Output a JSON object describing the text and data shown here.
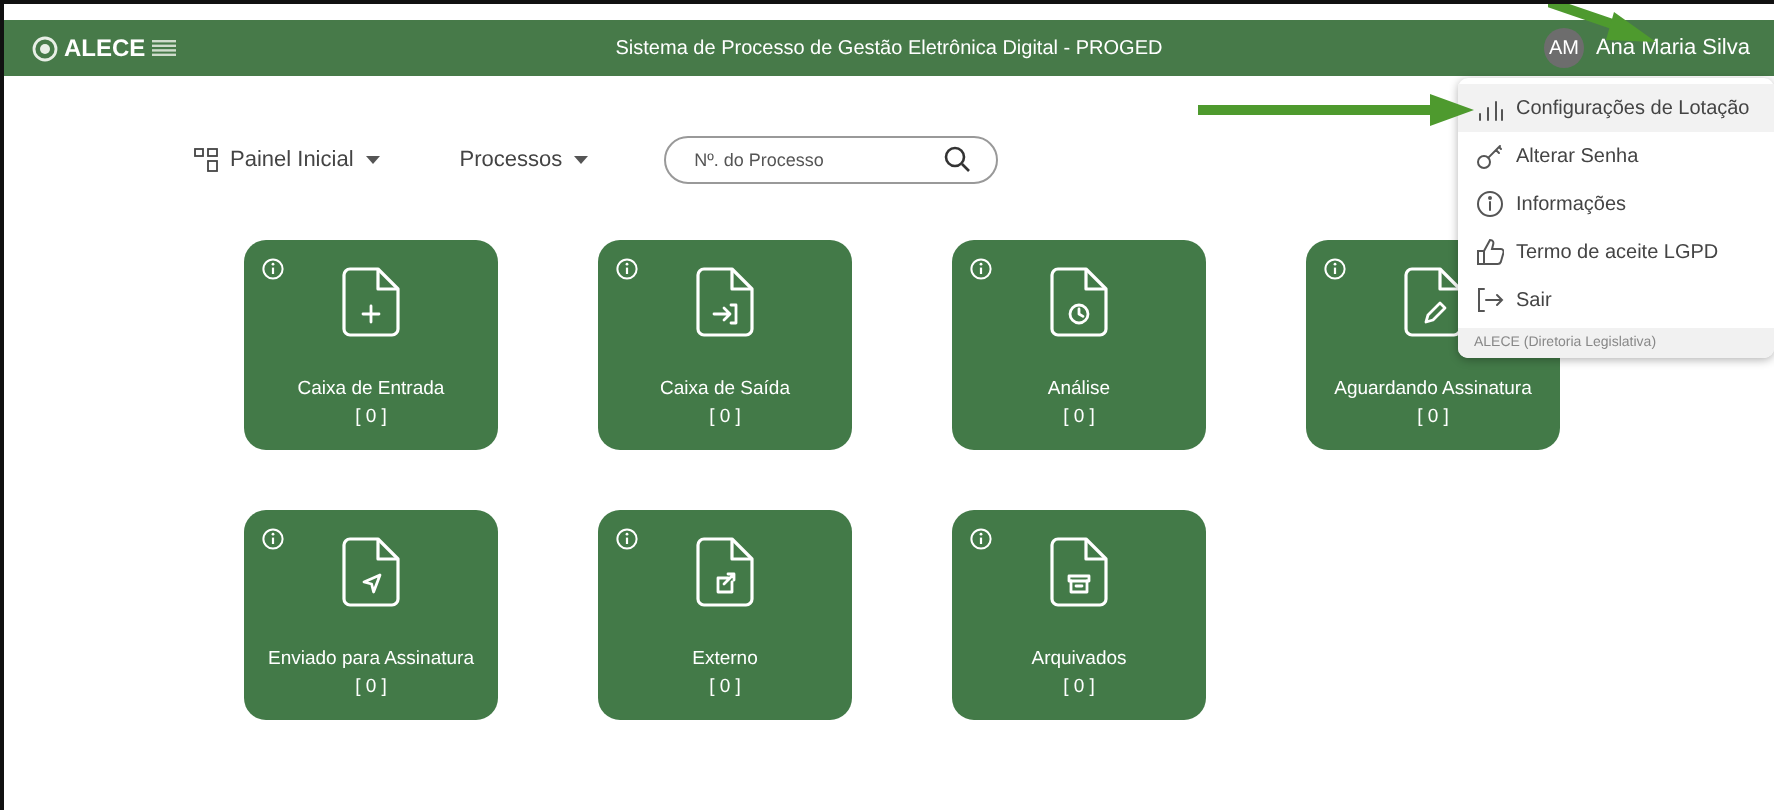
{
  "header": {
    "logo_text": "ALECE",
    "title": "Sistema de Processo de Gestão Eletrônica Digital - PROGED",
    "user": {
      "initials": "AM",
      "name": "Ana Maria Silva"
    }
  },
  "nav": {
    "items": [
      {
        "label": "Painel Inicial",
        "kind": "grid"
      },
      {
        "label": "Processos",
        "kind": "plain"
      }
    ],
    "search": {
      "placeholder": "Nº. do Processo"
    }
  },
  "cards": [
    {
      "label": "Caixa de Entrada",
      "count": "[ 0 ]",
      "kind": "plus"
    },
    {
      "label": "Caixa de Saída",
      "count": "[ 0 ]",
      "kind": "enter"
    },
    {
      "label": "Análise",
      "count": "[ 0 ]",
      "kind": "clock"
    },
    {
      "label": "Aguardando Assinatura",
      "count": "[ 0 ]",
      "kind": "pen"
    },
    {
      "label": "Enviado para Assinatura",
      "count": "[ 0 ]",
      "kind": "send"
    },
    {
      "label": "Externo",
      "count": "[ 0 ]",
      "kind": "external"
    },
    {
      "label": "Arquivados",
      "count": "[ 0 ]",
      "kind": "archive"
    }
  ],
  "user_menu": {
    "items": [
      {
        "label": "Configurações de Lotação",
        "kind": "chart",
        "selected": true
      },
      {
        "label": "Alterar Senha",
        "kind": "key",
        "selected": false
      },
      {
        "label": "Informações",
        "kind": "info",
        "selected": false
      },
      {
        "label": "Termo de aceite LGPD",
        "kind": "thumb",
        "selected": false
      },
      {
        "label": "Sair",
        "kind": "exit",
        "selected": false
      }
    ],
    "footer": "ALECE (Diretoria Legislativa)"
  }
}
